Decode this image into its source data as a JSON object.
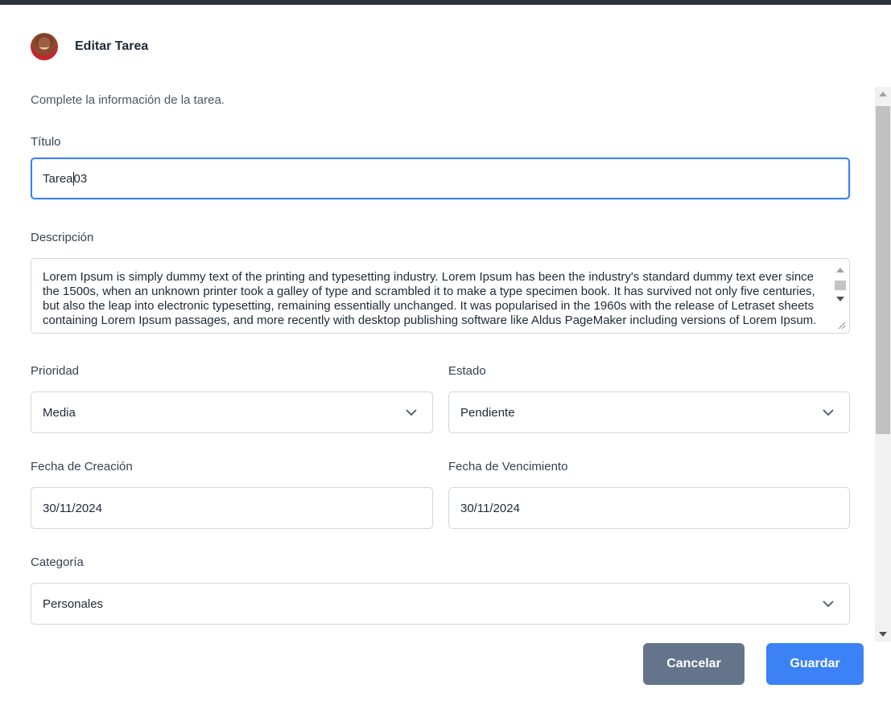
{
  "header": {
    "title": "Editar Tarea",
    "avatar_icon": "user-avatar"
  },
  "form": {
    "intro": "Complete la información de la tarea.",
    "title_label": "Título",
    "title_value_before_caret": "Tarea",
    "title_value_after_caret": "03",
    "description_label": "Descripción",
    "description_value": "Lorem Ipsum is simply dummy text of the printing and typesetting industry. Lorem Ipsum has been the industry's standard dummy text ever since the 1500s, when an unknown printer took a galley of type and scrambled it to make a type specimen book. It has survived not only five centuries, but also the leap into electronic typesetting, remaining essentially unchanged. It was popularised in the 1960s with the release of Letraset sheets containing Lorem Ipsum passages, and more recently with desktop publishing software like Aldus PageMaker including versions of Lorem Ipsum.",
    "priority_label": "Prioridad",
    "priority_value": "Media",
    "status_label": "Estado",
    "status_value": "Pendiente",
    "created_label": "Fecha de Creación",
    "created_value": "30/11/2024",
    "due_label": "Fecha de Vencimiento",
    "due_value": "30/11/2024",
    "category_label": "Categoría",
    "category_value": "Personales"
  },
  "actions": {
    "cancel_label": "Cancelar",
    "save_label": "Guardar"
  },
  "colors": {
    "primary": "#3b82f6",
    "secondary": "#64748b",
    "focus_border": "#3b82f6"
  }
}
